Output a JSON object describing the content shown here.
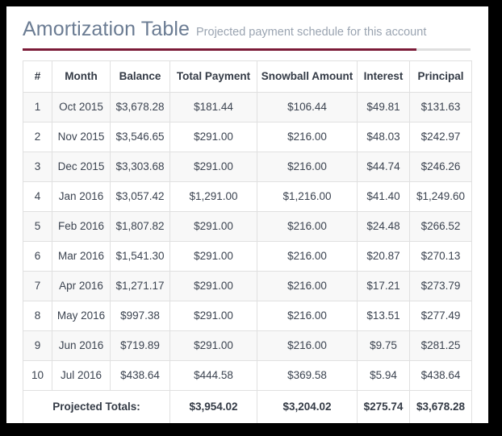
{
  "panel": {
    "title": "Amortization Table",
    "subtitle": "Projected payment schedule for this account",
    "accent_color": "#7b1b37",
    "title_color": "#6b7c93",
    "subtitle_color": "#9aa4b1"
  },
  "table": {
    "columns": [
      "#",
      "Month",
      "Balance",
      "Total Payment",
      "Snowball Amount",
      "Interest",
      "Principal"
    ],
    "rows": [
      {
        "num": "1",
        "month": "Oct 2015",
        "balance": "$3,678.28",
        "total_payment": "$181.44",
        "snowball": "$106.44",
        "interest": "$49.81",
        "principal": "$131.63"
      },
      {
        "num": "2",
        "month": "Nov 2015",
        "balance": "$3,546.65",
        "total_payment": "$291.00",
        "snowball": "$216.00",
        "interest": "$48.03",
        "principal": "$242.97"
      },
      {
        "num": "3",
        "month": "Dec 2015",
        "balance": "$3,303.68",
        "total_payment": "$291.00",
        "snowball": "$216.00",
        "interest": "$44.74",
        "principal": "$246.26"
      },
      {
        "num": "4",
        "month": "Jan 2016",
        "balance": "$3,057.42",
        "total_payment": "$1,291.00",
        "snowball": "$1,216.00",
        "interest": "$41.40",
        "principal": "$1,249.60"
      },
      {
        "num": "5",
        "month": "Feb 2016",
        "balance": "$1,807.82",
        "total_payment": "$291.00",
        "snowball": "$216.00",
        "interest": "$24.48",
        "principal": "$266.52"
      },
      {
        "num": "6",
        "month": "Mar 2016",
        "balance": "$1,541.30",
        "total_payment": "$291.00",
        "snowball": "$216.00",
        "interest": "$20.87",
        "principal": "$270.13"
      },
      {
        "num": "7",
        "month": "Apr 2016",
        "balance": "$1,271.17",
        "total_payment": "$291.00",
        "snowball": "$216.00",
        "interest": "$17.21",
        "principal": "$273.79"
      },
      {
        "num": "8",
        "month": "May 2016",
        "balance": "$997.38",
        "total_payment": "$291.00",
        "snowball": "$216.00",
        "interest": "$13.51",
        "principal": "$277.49"
      },
      {
        "num": "9",
        "month": "Jun 2016",
        "balance": "$719.89",
        "total_payment": "$291.00",
        "snowball": "$216.00",
        "interest": "$9.75",
        "principal": "$281.25"
      },
      {
        "num": "10",
        "month": "Jul 2016",
        "balance": "$438.64",
        "total_payment": "$444.58",
        "snowball": "$369.58",
        "interest": "$5.94",
        "principal": "$438.64"
      }
    ],
    "footer": {
      "label": "Projected Totals:",
      "total_payment": "$3,954.02",
      "snowball": "$3,204.02",
      "interest": "$275.74",
      "principal": "$3,678.28"
    }
  }
}
